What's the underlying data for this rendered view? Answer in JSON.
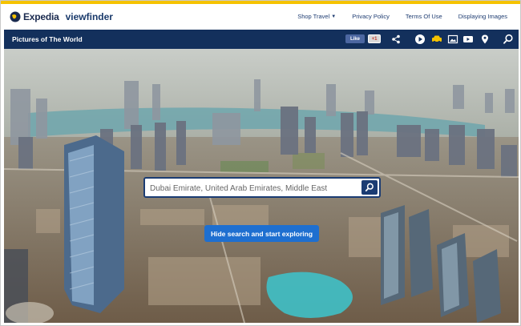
{
  "header": {
    "brand": "Expedia",
    "product": "viewfinder",
    "nav": [
      {
        "label": "Shop Travel",
        "has_caret": true
      },
      {
        "label": "Privacy Policy"
      },
      {
        "label": "Terms Of Use"
      },
      {
        "label": "Displaying Images"
      }
    ]
  },
  "subheader": {
    "title": "Pictures of The World",
    "facebook_like": "Like",
    "google_plus": "+1",
    "icons": [
      "share-icon",
      "play-icon",
      "car-icon",
      "image-icon",
      "video-icon",
      "map-pin-icon",
      "search-icon"
    ]
  },
  "hero": {
    "search": {
      "value": "Dubai Emirate, United Arab Emirates, Middle East",
      "placeholder": ""
    },
    "explore_button": "Hide search and start exploring"
  },
  "colors": {
    "accent_gold": "#f5c200",
    "navy": "#13305c",
    "button_blue": "#1e6fd0"
  }
}
